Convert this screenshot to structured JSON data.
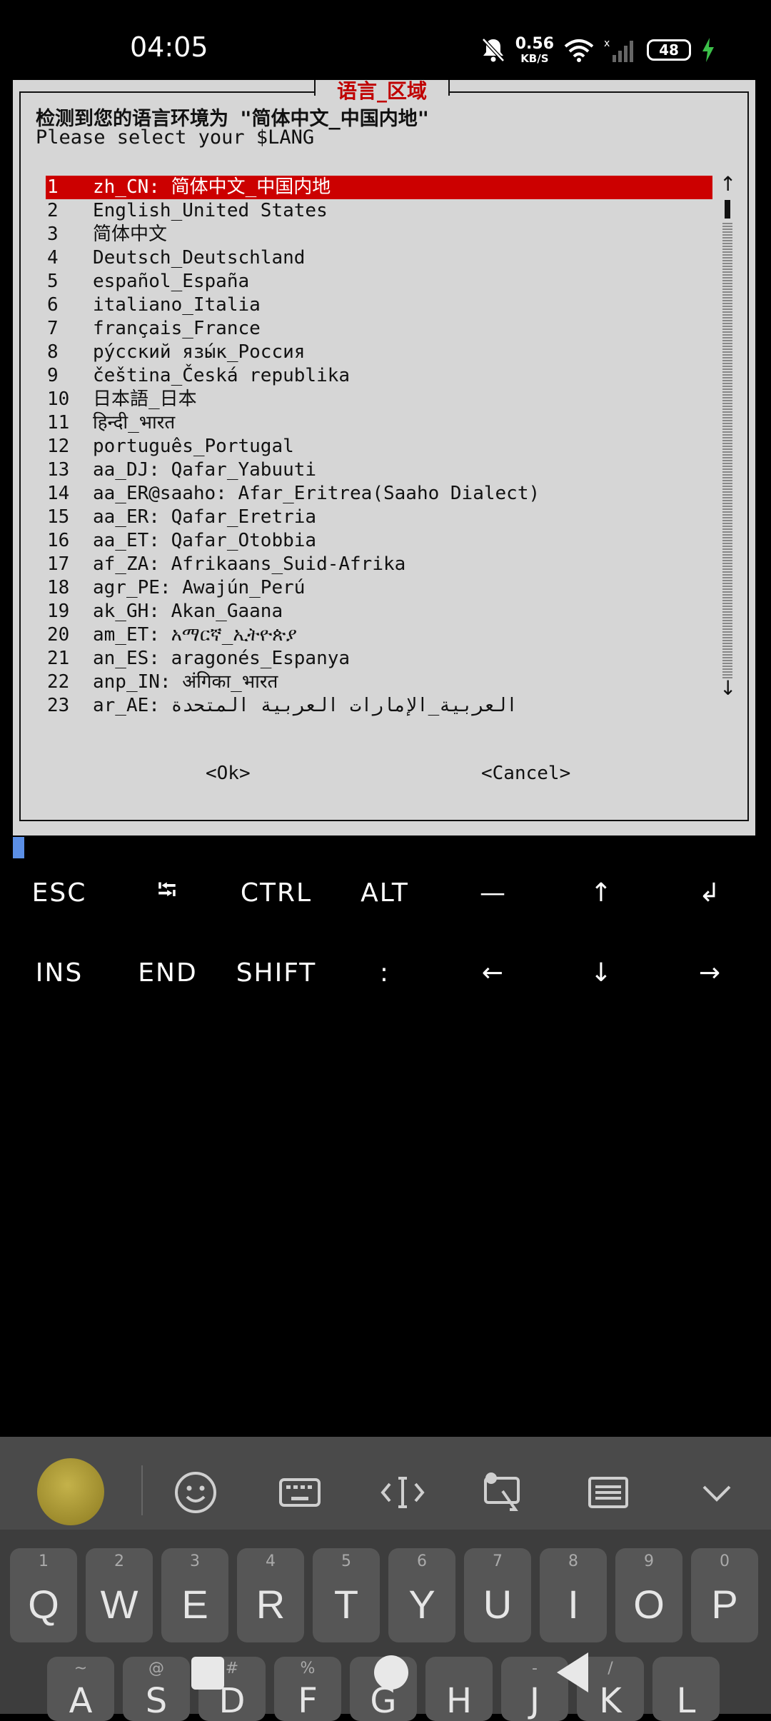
{
  "status_bar": {
    "time": "04:05",
    "net_speed_value": "0.56",
    "net_speed_unit": "KB/S",
    "battery": "48",
    "icons": [
      "bell-muted-icon",
      "wifi-icon",
      "signal-icon",
      "battery-icon",
      "charging-icon"
    ]
  },
  "dialog": {
    "title": "语言_区域",
    "prompt_line1": "检测到您的语言环境为 \"简体中文_中国内地\"",
    "prompt_line2": "Please select your $LANG",
    "selected_index": 1,
    "items": [
      {
        "num": "1",
        "label": "zh_CN: 简体中文_中国内地"
      },
      {
        "num": "2",
        "label": "English_United States"
      },
      {
        "num": "3",
        "label": "简体中文"
      },
      {
        "num": "4",
        "label": "Deutsch_Deutschland"
      },
      {
        "num": "5",
        "label": "español_España"
      },
      {
        "num": "6",
        "label": "italiano_Italia"
      },
      {
        "num": "7",
        "label": "français_France"
      },
      {
        "num": "8",
        "label": "ру́сский язы́к_Россия"
      },
      {
        "num": "9",
        "label": "čeština_Česká republika"
      },
      {
        "num": "10",
        "label": "日本語_日本"
      },
      {
        "num": "11",
        "label": "हिन्दी_भारत"
      },
      {
        "num": "12",
        "label": "português_Portugal"
      },
      {
        "num": "13",
        "label": "aa_DJ: Qafar_Yabuuti"
      },
      {
        "num": "14",
        "label": "aa_ER@saaho: Afar_Eritrea(Saaho Dialect)"
      },
      {
        "num": "15",
        "label": "aa_ER: Qafar_Eretria"
      },
      {
        "num": "16",
        "label": "aa_ET: Qafar_Otobbia"
      },
      {
        "num": "17",
        "label": "af_ZA: Afrikaans_Suid-Afrika"
      },
      {
        "num": "18",
        "label": "agr_PE: Awajún_Perú"
      },
      {
        "num": "19",
        "label": "ak_GH: Akan_Gaana"
      },
      {
        "num": "20",
        "label": "am_ET: አማርኛ_ኢትዮጵያ"
      },
      {
        "num": "21",
        "label": "an_ES: aragonés_Espanya"
      },
      {
        "num": "22",
        "label": "anp_IN: अंगिका_भारत"
      },
      {
        "num": "23",
        "label": "ar_AE: العربية_الإمارات العربية المتحدة"
      }
    ],
    "ok_label": "<Ok>",
    "cancel_label": "<Cancel>",
    "scroll_up": "↑",
    "scroll_down": "↓"
  },
  "extra_keys": {
    "row1": [
      "ESC",
      "⭾",
      "CTRL",
      "ALT",
      "—",
      "↑",
      "↲"
    ],
    "row2": [
      "INS",
      "END",
      "SHIFT",
      ":",
      "←",
      "↓",
      "→"
    ]
  },
  "keyboard": {
    "row1": [
      {
        "num": "1",
        "ch": "Q"
      },
      {
        "num": "2",
        "ch": "W"
      },
      {
        "num": "3",
        "ch": "E"
      },
      {
        "num": "4",
        "ch": "R"
      },
      {
        "num": "5",
        "ch": "T"
      },
      {
        "num": "6",
        "ch": "Y"
      },
      {
        "num": "7",
        "ch": "U"
      },
      {
        "num": "8",
        "ch": "I"
      },
      {
        "num": "9",
        "ch": "O"
      },
      {
        "num": "0",
        "ch": "P"
      }
    ],
    "row2": [
      {
        "num": "~",
        "ch": "A"
      },
      {
        "num": "@",
        "ch": "S"
      },
      {
        "num": "#",
        "ch": "D"
      },
      {
        "num": "%",
        "ch": "F"
      },
      {
        "num": "",
        "ch": "G"
      },
      {
        "num": "",
        "ch": "H"
      },
      {
        "num": "-",
        "ch": "J"
      },
      {
        "num": "/",
        "ch": "K"
      },
      {
        "num": "",
        "ch": "L"
      }
    ]
  },
  "colors": {
    "selection": "#cc0000",
    "dialog_bg": "#d6d6d6",
    "title": "#c00000",
    "cursor": "#5b8fe6"
  }
}
